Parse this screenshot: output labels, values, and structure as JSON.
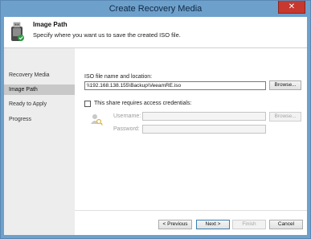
{
  "window": {
    "title": "Create Recovery Media"
  },
  "header": {
    "title": "Image Path",
    "subtitle": "Specify where you want us to save the created ISO file."
  },
  "steps": [
    {
      "label": "Recovery Media",
      "active": false
    },
    {
      "label": "Image Path",
      "active": true
    },
    {
      "label": "Ready to Apply",
      "active": false
    },
    {
      "label": "Progress",
      "active": false
    }
  ],
  "form": {
    "iso_label": "ISO file name and location:",
    "iso_value": "\\\\192.168.138.155\\Backup\\VeeamRE.iso",
    "browse_label": "Browse...",
    "credentials_label": "This share requires access credentials:",
    "credentials_checked": false,
    "username_label": "Username:",
    "username_value": "",
    "password_label": "Password:",
    "password_value": "",
    "cred_browse_label": "Browse..."
  },
  "buttons": {
    "previous": "< Previous",
    "next": "Next >",
    "finish": "Finish",
    "cancel": "Cancel"
  },
  "icons": {
    "close": "close-icon",
    "header": "usb-drive-icon",
    "credentials": "user-key-icon"
  }
}
